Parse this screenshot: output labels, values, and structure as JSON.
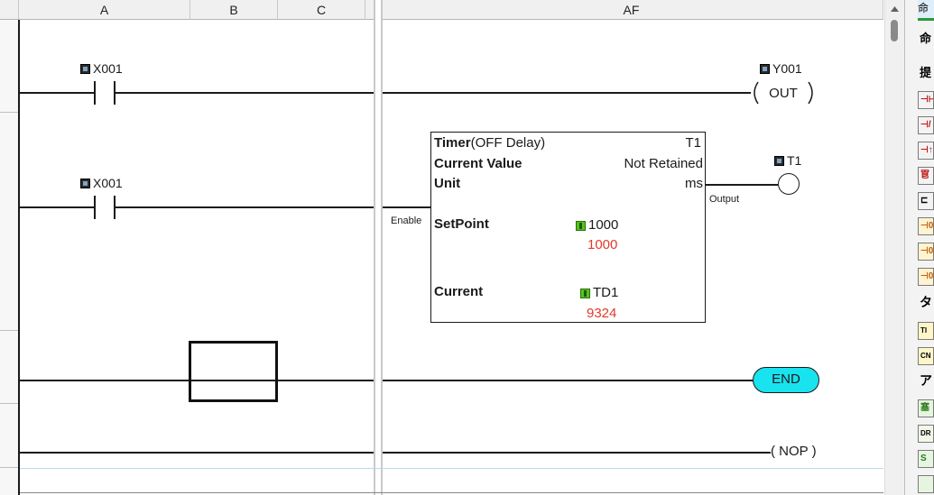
{
  "columns": {
    "a": "A",
    "b": "B",
    "c": "C",
    "af": "AF"
  },
  "rung1": {
    "contact_device": "X001",
    "coil_device": "Y001",
    "coil_label": "OUT"
  },
  "rung2": {
    "contact_device": "X001",
    "timer_title": "Timer",
    "timer_mode": "(OFF Delay)",
    "timer_id": "T1",
    "current_value_label": "Current Value",
    "current_value": "Not Retained",
    "unit_label": "Unit",
    "unit_value": "ms",
    "enable_label": "Enable",
    "output_label": "Output",
    "setpoint_label": "SetPoint",
    "setpoint_value": "1000",
    "setpoint_live": "1000",
    "current_label": "Current",
    "current_device": "TD1",
    "current_live": "9324",
    "output_coil_device": "T1"
  },
  "rung3": {
    "end_label": "END"
  },
  "rung4": {
    "nop_label": "( NOP )"
  },
  "palette": {
    "header": "命",
    "items": [
      "命",
      "提",
      "⊣⊢",
      "⊣/⊢",
      "⊣↑⊢",
      "冟",
      "⊏",
      "⊣0⊢",
      "⊣0⊢",
      "⊣0⊢",
      "タ",
      "TI",
      "CN",
      "ア",
      "塞",
      "DR",
      "S"
    ]
  },
  "colors": {
    "end_fill": "#19e3ef",
    "live_value": "#e03a2a",
    "palette_accent": "#2a9a3a"
  }
}
